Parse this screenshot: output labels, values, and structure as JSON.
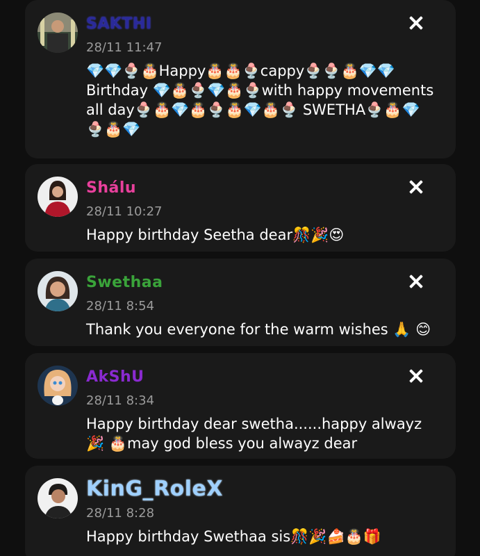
{
  "comments": [
    {
      "name": "SAKTHI",
      "time": "28/11 11:47",
      "message": "💎💎🍨🎂Happy🎂🎂🍨cappy🍨🍨🎂💎💎 Birthday 💎🎂🍨💎🎂🍨with happy movements all day🍨🎂💎🎂🍨🎂💎🎂🍨 SWETHA🍨🎂💎🍨🎂💎",
      "has_close": true
    },
    {
      "name": "Shálu",
      "time": "28/11 10:27",
      "message": "Happy birthday Seetha dear🎊🎉😍",
      "has_close": true
    },
    {
      "name": "Swethaa",
      "time": "28/11 8:54",
      "message": "Thank you everyone for the warm wishes 🙏 😊",
      "has_close": true
    },
    {
      "name": "AkShU",
      "time": "28/11 8:34",
      "message": "Happy birthday dear swetha......happy alwayz🎉 🎂may god bless you alwayz dear",
      "has_close": true
    },
    {
      "name": "KinG_RoleX",
      "time": "28/11 8:28",
      "message": "Happy birthday Swethaa sis🎊🎉🍰🎂🎁",
      "has_close": false
    }
  ],
  "colors": {
    "background": "#0f0f0f",
    "card": "#1a1a1a",
    "timestamp": "#9b9b9b",
    "sakthi_name": "#2a2a9a",
    "shalu_name": "#e8409c",
    "swethaa_name": "#3aa33a",
    "akshu_name": "#8a2ad0",
    "king_name": "#9fd0ff"
  },
  "icons": {
    "close": "close-icon"
  }
}
